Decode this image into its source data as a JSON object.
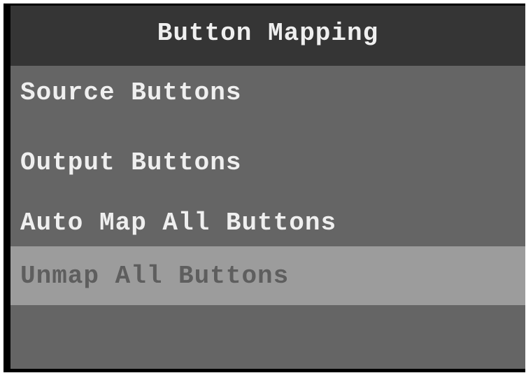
{
  "header": {
    "title": "Button Mapping"
  },
  "menu": {
    "items": [
      {
        "label": "Source Buttons"
      },
      {
        "label": "Output Buttons"
      },
      {
        "label": "Auto Map All Buttons"
      },
      {
        "label": "Unmap All Buttons"
      }
    ],
    "selected_index": 3
  },
  "colors": {
    "frame": "#000000",
    "header_bg": "#353535",
    "menu_bg": "#656565",
    "selected_bg": "#9c9c9c",
    "text": "#efefef",
    "selected_text": "#5e5e5e"
  }
}
